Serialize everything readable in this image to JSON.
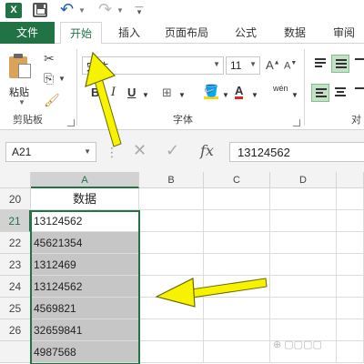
{
  "quick_access": {
    "app_icon": "excel-logo-icon",
    "app_letter": "X",
    "save_icon": "save-icon",
    "undo_icon": "undo-icon",
    "redo_icon": "redo-icon"
  },
  "ribbon_tabs": [
    {
      "label": "文件"
    },
    {
      "label": "开始"
    },
    {
      "label": "插入"
    },
    {
      "label": "页面布局"
    },
    {
      "label": "公式"
    },
    {
      "label": "数据"
    },
    {
      "label": "审阅"
    }
  ],
  "clipboard_group": {
    "paste_label": "粘贴",
    "group_label": "剪贴板"
  },
  "font_group": {
    "font_name": "宋体",
    "font_size": "11",
    "bold": "B",
    "italic": "I",
    "underline": "U",
    "phonetic_label": "wén",
    "group_label": "字体"
  },
  "alignment_group": {
    "group_label": "对"
  },
  "formula_bar": {
    "name_box": "A21",
    "fx_label": "fx",
    "content": "13124562"
  },
  "grid": {
    "columns": [
      "A",
      "B",
      "C",
      "D"
    ],
    "rows": [
      {
        "row": "20",
        "a": "数据"
      },
      {
        "row": "21",
        "a": "13124562"
      },
      {
        "row": "22",
        "a": "45621354"
      },
      {
        "row": "23",
        "a": "1312469"
      },
      {
        "row": "24",
        "a": "13124562"
      },
      {
        "row": "25",
        "a": "4569821"
      },
      {
        "row": "26",
        "a": "32659841"
      },
      {
        "row": "",
        "a": "4987568"
      }
    ]
  },
  "colors": {
    "accent": "#217346",
    "selection": "#c6c6c6",
    "arrow": "#f7f300"
  }
}
